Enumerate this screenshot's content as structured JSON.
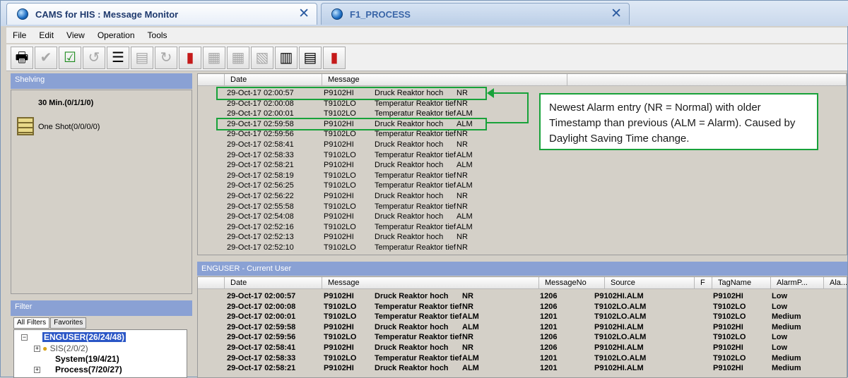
{
  "tabs": [
    {
      "title": "CAMS for HIS : Message Monitor",
      "icon": "globe-icon",
      "active": true
    },
    {
      "title": "F1_PROCESS",
      "icon": "globe-icon",
      "active": false
    }
  ],
  "menu": [
    "File",
    "Edit",
    "View",
    "Operation",
    "Tools"
  ],
  "shelving": {
    "title": "Shelving",
    "items": [
      "30 Min.(0/1/1/0)",
      "One Shot(0/0/0/0)"
    ]
  },
  "filter": {
    "title": "Filter",
    "tabs": [
      "All Filters",
      "Favorites"
    ],
    "tree": [
      "ENGUSER(26/24/48)",
      "SIS(2/0/2)",
      "System(19/4/21)",
      "Process(7/20/27)"
    ]
  },
  "upper_list": {
    "columns": [
      "Date",
      "Message"
    ],
    "rows": [
      [
        "29-Oct-17 02:00:57",
        "P9102HI",
        "Druck Reaktor hoch",
        "NR"
      ],
      [
        "29-Oct-17 02:00:08",
        "T9102LO",
        "Temperatur Reaktor tief",
        "NR"
      ],
      [
        "29-Oct-17 02:00:01",
        "T9102LO",
        "Temperatur Reaktor tief",
        "ALM"
      ],
      [
        "29-Oct-17 02:59:58",
        "P9102HI",
        "Druck Reaktor hoch",
        "ALM"
      ],
      [
        "29-Oct-17 02:59:56",
        "T9102LO",
        "Temperatur Reaktor tief",
        "NR"
      ],
      [
        "29-Oct-17 02:58:41",
        "P9102HI",
        "Druck Reaktor hoch",
        "NR"
      ],
      [
        "29-Oct-17 02:58:33",
        "T9102LO",
        "Temperatur Reaktor tief",
        "ALM"
      ],
      [
        "29-Oct-17 02:58:21",
        "P9102HI",
        "Druck Reaktor hoch",
        "ALM"
      ],
      [
        "29-Oct-17 02:58:19",
        "T9102LO",
        "Temperatur Reaktor tief",
        "NR"
      ],
      [
        "29-Oct-17 02:56:25",
        "T9102LO",
        "Temperatur Reaktor tief",
        "ALM"
      ],
      [
        "29-Oct-17 02:56:22",
        "P9102HI",
        "Druck Reaktor hoch",
        "NR"
      ],
      [
        "29-Oct-17 02:55:58",
        "T9102LO",
        "Temperatur Reaktor tief",
        "NR"
      ],
      [
        "29-Oct-17 02:54:08",
        "P9102HI",
        "Druck Reaktor hoch",
        "ALM"
      ],
      [
        "29-Oct-17 02:52:16",
        "T9102LO",
        "Temperatur Reaktor tief",
        "ALM"
      ],
      [
        "29-Oct-17 02:52:13",
        "P9102HI",
        "Druck Reaktor hoch",
        "NR"
      ],
      [
        "29-Oct-17 02:52:10",
        "T9102LO",
        "Temperatur Reaktor tief",
        "NR"
      ]
    ]
  },
  "lower_list": {
    "title": "ENGUSER - Current User",
    "columns": [
      "Date",
      "Message",
      "MessageNo",
      "Source",
      "F",
      "TagName",
      "AlarmP...",
      "Ala..."
    ],
    "rows": [
      [
        "29-Oct-17 02:00:57",
        "P9102HI",
        "Druck Reaktor hoch",
        "NR",
        "1206",
        "P9102HI.ALM",
        "P9102HI",
        "Low"
      ],
      [
        "29-Oct-17 02:00:08",
        "T9102LO",
        "Temperatur Reaktor tief",
        "NR",
        "1206",
        "T9102LO.ALM",
        "T9102LO",
        "Low"
      ],
      [
        "29-Oct-17 02:00:01",
        "T9102LO",
        "Temperatur Reaktor tief",
        "ALM",
        "1201",
        "T9102LO.ALM",
        "T9102LO",
        "Medium"
      ],
      [
        "29-Oct-17 02:59:58",
        "P9102HI",
        "Druck Reaktor hoch",
        "ALM",
        "1201",
        "P9102HI.ALM",
        "P9102HI",
        "Medium"
      ],
      [
        "29-Oct-17 02:59:56",
        "T9102LO",
        "Temperatur Reaktor tief",
        "NR",
        "1206",
        "T9102LO.ALM",
        "T9102LO",
        "Low"
      ],
      [
        "29-Oct-17 02:58:41",
        "P9102HI",
        "Druck Reaktor hoch",
        "NR",
        "1206",
        "P9102HI.ALM",
        "P9102HI",
        "Low"
      ],
      [
        "29-Oct-17 02:58:33",
        "T9102LO",
        "Temperatur Reaktor tief",
        "ALM",
        "1201",
        "T9102LO.ALM",
        "T9102LO",
        "Medium"
      ],
      [
        "29-Oct-17 02:58:21",
        "P9102HI",
        "Druck Reaktor hoch",
        "ALM",
        "1201",
        "P9102HI.ALM",
        "P9102HI",
        "Medium"
      ]
    ]
  },
  "annotation": "Newest Alarm entry (NR = Normal) with older Timestamp than previous (ALM = Alarm). Caused by Daylight Saving Time change.",
  "colors": {
    "highlight": "#18a23a",
    "panel_header": "#8aa1d4",
    "tab_text": "#1f3a6e"
  }
}
